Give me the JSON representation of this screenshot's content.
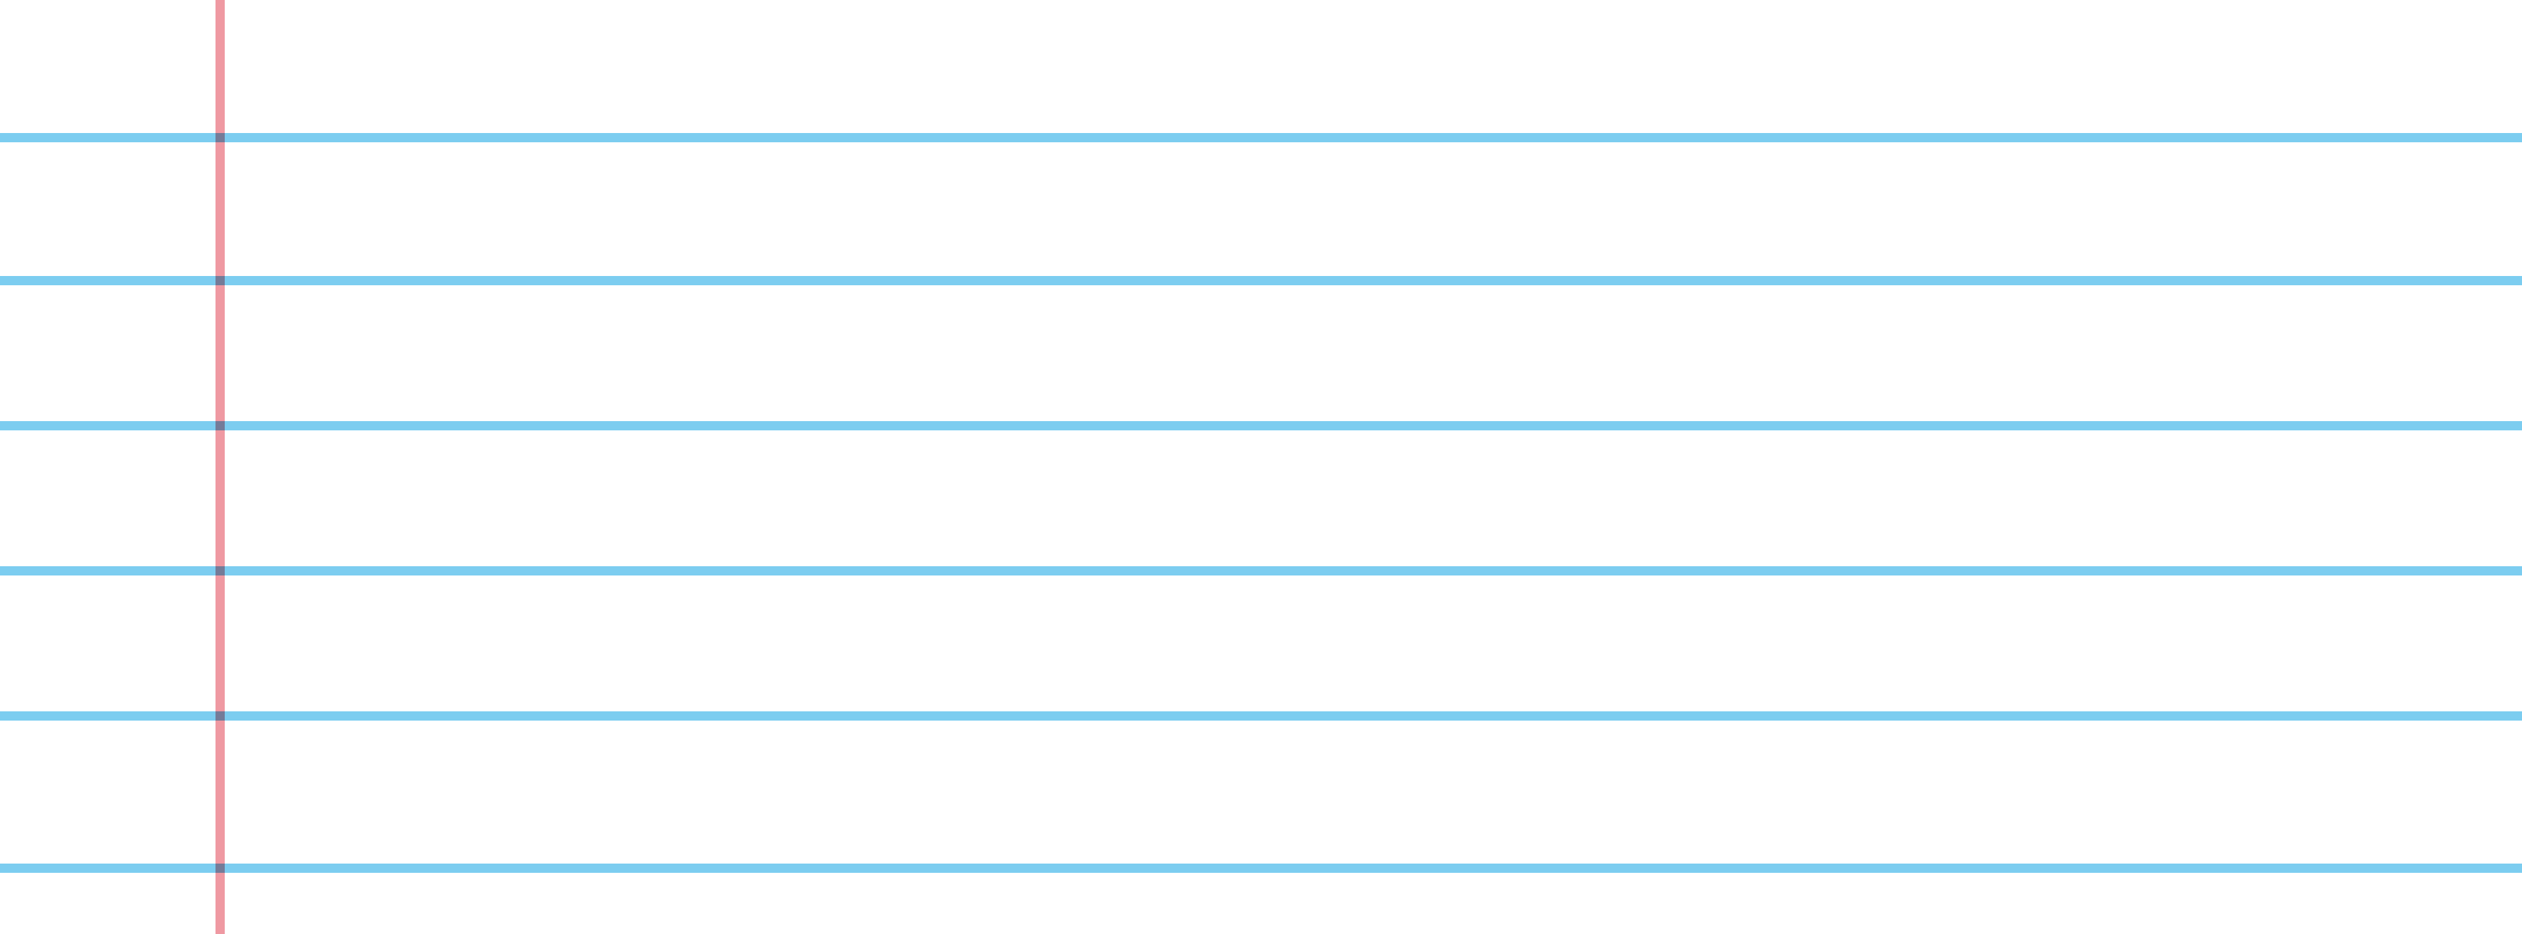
{
  "paper": {
    "style": "lined notebook paper",
    "background_color": "#ffffff",
    "rule_line_color": "#7ccdf0",
    "margin_line_color": "#e86e7a",
    "rule_line_count": 6,
    "margin_line_count": 1
  }
}
